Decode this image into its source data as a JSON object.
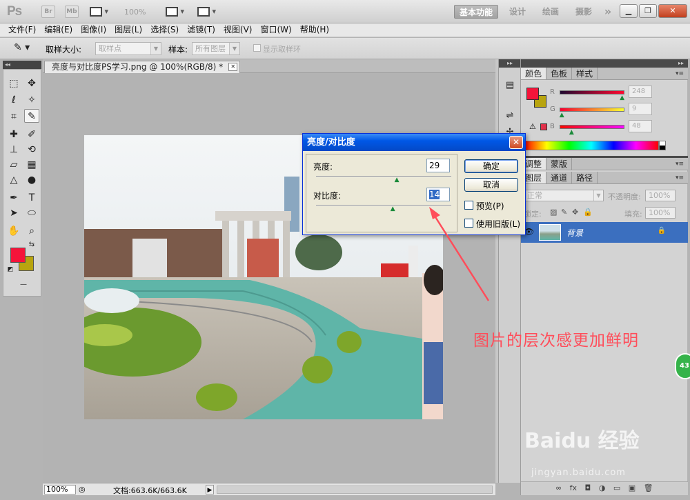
{
  "app": {
    "logo": "Ps",
    "chip_br": "Br",
    "chip_mb": "Mb",
    "zoom": "100%",
    "workspaces": [
      "基本功能",
      "设计",
      "绘画",
      "摄影"
    ],
    "more": "»"
  },
  "menu": [
    "文件(F)",
    "编辑(E)",
    "图像(I)",
    "图层(L)",
    "选择(S)",
    "滤镜(T)",
    "视图(V)",
    "窗口(W)",
    "帮助(H)"
  ],
  "options": {
    "sample_size_label": "取样大小:",
    "sample_size_value": "取样点",
    "sample_label": "样本:",
    "sample_value": "所有图层",
    "show_ring_label": "显示取样环"
  },
  "document": {
    "tab_title": "亮度与对比度PS学习.png @ 100%(RGB/8) *",
    "status_zoom": "100%",
    "status_doc": "文档:663.6K/663.6K"
  },
  "color_panel": {
    "tabs": [
      "颜色",
      "色板",
      "样式"
    ],
    "r_label": "R",
    "r_value": "248",
    "r_fraction": 0.97,
    "g_label": "G",
    "g_value": "9",
    "g_fraction": 0.04,
    "b_label": "B",
    "b_value": "48",
    "b_fraction": 0.19
  },
  "adjust_panel": {
    "tabs": [
      "调整",
      "蒙版"
    ]
  },
  "layers_panel": {
    "tabs": [
      "图层",
      "通道",
      "路径"
    ],
    "blend_mode": "正常",
    "opacity_label": "不透明度:",
    "opacity_value": "100%",
    "lock_label": "锁定:",
    "fill_label": "填充:",
    "fill_value": "100%",
    "layer_name": "背景",
    "footer_icons": "∞ fx ◘ ◑ ▭ ▣ 🗑"
  },
  "dialog": {
    "title": "亮度/对比度",
    "brightness_label": "亮度:",
    "brightness_value": "29",
    "brightness_fraction": 0.6,
    "contrast_label": "对比度:",
    "contrast_value": "14",
    "contrast_fraction": 0.57,
    "ok": "确定",
    "cancel": "取消",
    "preview": "预览(P)",
    "legacy": "使用旧版(L)"
  },
  "annotation": {
    "text": "图片的层次感更加鲜明",
    "badge": "43",
    "watermark": "Baidu 经验",
    "watermark_url": "jingyan.baidu.com"
  }
}
